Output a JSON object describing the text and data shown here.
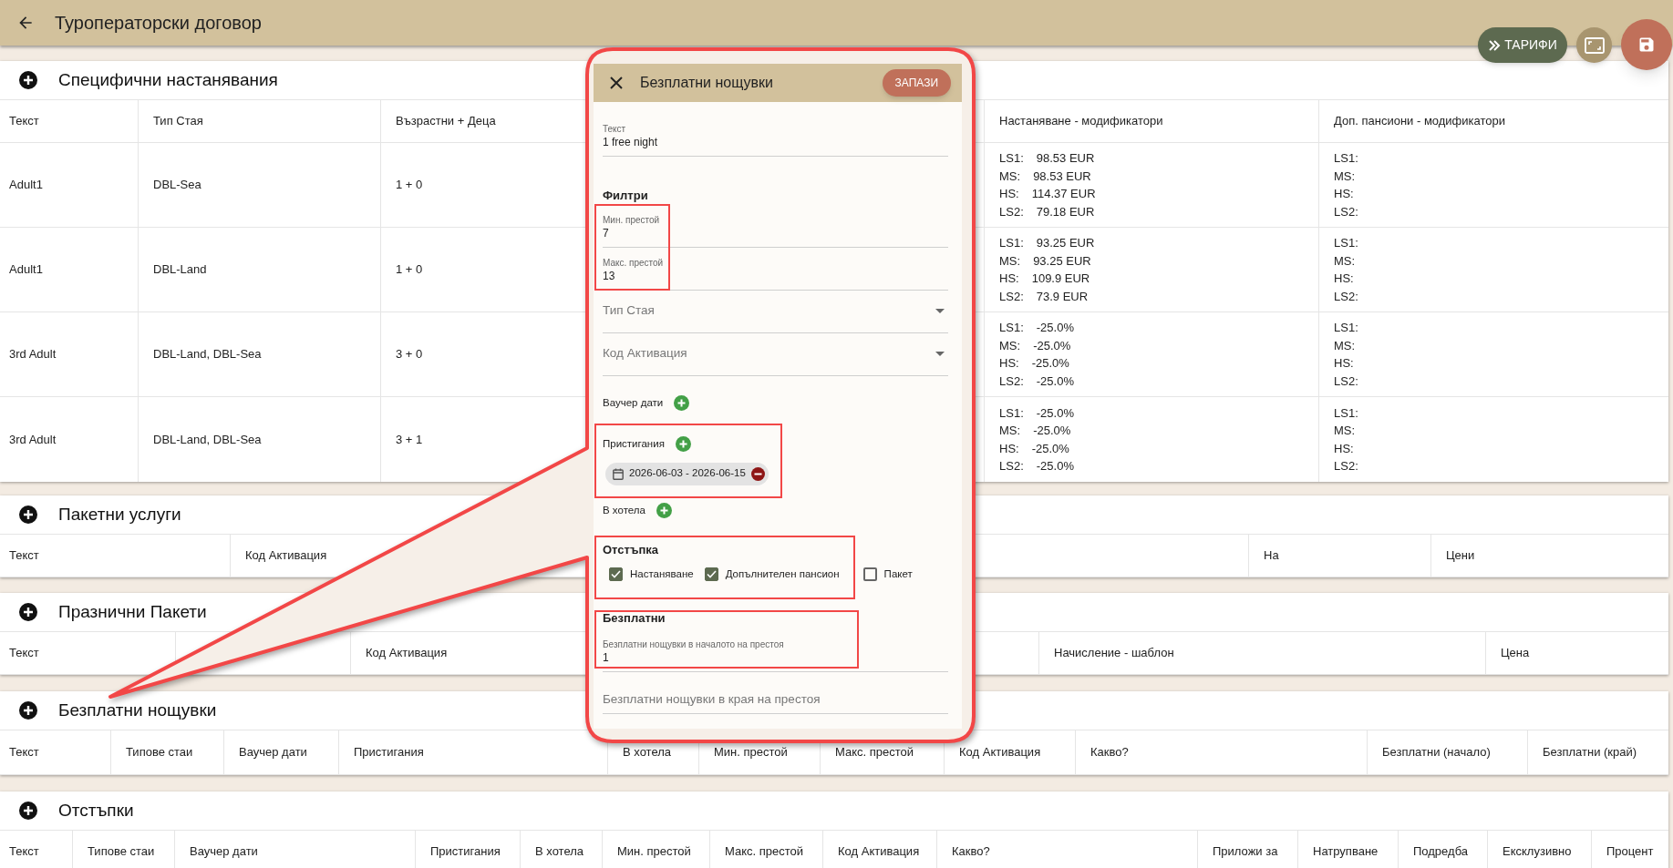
{
  "app_bar": {
    "title": "Туроператорски договор"
  },
  "actions": {
    "rates_label": "ТАРИФИ"
  },
  "sections": [
    {
      "title": "Специфични настанявания",
      "columns": [
        "Текст",
        "Тип Стая",
        "Възрастни + Деца",
        "Настаняване - модификатори",
        "Доп. пансиони - модификатори"
      ],
      "rows": [
        [
          "Adult1",
          "DBL-Sea",
          "1 + 0",
          [
            {
              "label": "LS1:",
              "value": "98.53 EUR"
            },
            {
              "label": "MS:",
              "value": "98.53 EUR"
            },
            {
              "label": "HS:",
              "value": "114.37 EUR"
            },
            {
              "label": "LS2:",
              "value": "79.18 EUR"
            }
          ],
          [
            {
              "label": "LS1:"
            },
            {
              "label": "MS:"
            },
            {
              "label": "HS:"
            },
            {
              "label": "LS2:"
            }
          ]
        ],
        [
          "Adult1",
          "DBL-Land",
          "1 + 0",
          [
            {
              "label": "LS1:",
              "value": "93.25 EUR"
            },
            {
              "label": "MS:",
              "value": "93.25 EUR"
            },
            {
              "label": "HS:",
              "value": "109.9 EUR"
            },
            {
              "label": "LS2:",
              "value": "73.9 EUR"
            }
          ],
          [
            {
              "label": "LS1:"
            },
            {
              "label": "MS:"
            },
            {
              "label": "HS:"
            },
            {
              "label": "LS2:"
            }
          ]
        ],
        [
          "3rd Adult",
          "DBL-Land, DBL-Sea",
          "3 + 0",
          [
            {
              "label": "LS1:",
              "value": "-25.0%"
            },
            {
              "label": "MS:",
              "value": "-25.0%"
            },
            {
              "label": "HS:",
              "value": "-25.0%"
            },
            {
              "label": "LS2:",
              "value": "-25.0%"
            }
          ],
          [
            {
              "label": "LS1:"
            },
            {
              "label": "MS:"
            },
            {
              "label": "HS:"
            },
            {
              "label": "LS2:"
            }
          ]
        ],
        [
          "3rd Adult",
          "DBL-Land, DBL-Sea",
          "3 + 1",
          [
            {
              "label": "LS1:",
              "value": "-25.0%"
            },
            {
              "label": "MS:",
              "value": "-25.0%"
            },
            {
              "label": "HS:",
              "value": "-25.0%"
            },
            {
              "label": "LS2:",
              "value": "-25.0%"
            }
          ],
          [
            {
              "label": "LS1:"
            },
            {
              "label": "MS:"
            },
            {
              "label": "HS:"
            },
            {
              "label": "LS2:"
            }
          ]
        ]
      ]
    },
    {
      "title": "Пакетни услуги",
      "columns": [
        "Текст",
        "Код Активация",
        "На",
        "Цени"
      ]
    },
    {
      "title": "Празнични Пакети",
      "columns": [
        "Текст",
        "Код Активация",
        "Начисление - шаблон",
        "Цена"
      ]
    },
    {
      "title": "Безплатни нощувки",
      "columns": [
        "Текст",
        "Типове стаи",
        "Ваучер дати",
        "Пристигания",
        "В хотела",
        "Мин. престой",
        "Макс. престой",
        "Код Активация",
        "Какво?",
        "Безплатни (начало)",
        "Безплатни (край)"
      ]
    },
    {
      "title": "Отстъпки",
      "columns": [
        "Текст",
        "Типове стаи",
        "Ваучер дати",
        "Пристигания",
        "В хотела",
        "Мин. престой",
        "Макс. престой",
        "Код Активация",
        "Какво?",
        "Приложи за",
        "Натрупване",
        "Подредба",
        "Ексклузивно",
        "Процент"
      ]
    }
  ],
  "dialog": {
    "title": "Безплатни нощувки",
    "save_label": "ЗАПАЗИ",
    "text_field": {
      "label": "Текст",
      "value": "1 free night"
    },
    "filters_heading": "Филтри",
    "min_stay": {
      "label": "Мин. престой",
      "value": "7"
    },
    "max_stay": {
      "label": "Макс. престой",
      "value": "13"
    },
    "selects": [
      {
        "placeholder": "Тип Стая"
      },
      {
        "placeholder": "Код Активация"
      }
    ],
    "date_groups": [
      {
        "label": "Ваучер дати"
      },
      {
        "label": "Пристигания",
        "chips": [
          "2026-06-03 - 2026-06-15"
        ]
      },
      {
        "label": "В хотела"
      }
    ],
    "discount": {
      "heading": "Отстъпка",
      "options": [
        {
          "label": "Настаняване",
          "checked": true
        },
        {
          "label": "Допълнителен пансион",
          "checked": true
        },
        {
          "label": "Пакет",
          "checked": false
        }
      ]
    },
    "free": {
      "heading": "Безплатни",
      "start": {
        "label": "Безплатни нощувки в началото на престоя",
        "value": "1"
      },
      "end": {
        "placeholder": "Безплатни нощувки в края на престоя"
      }
    }
  }
}
